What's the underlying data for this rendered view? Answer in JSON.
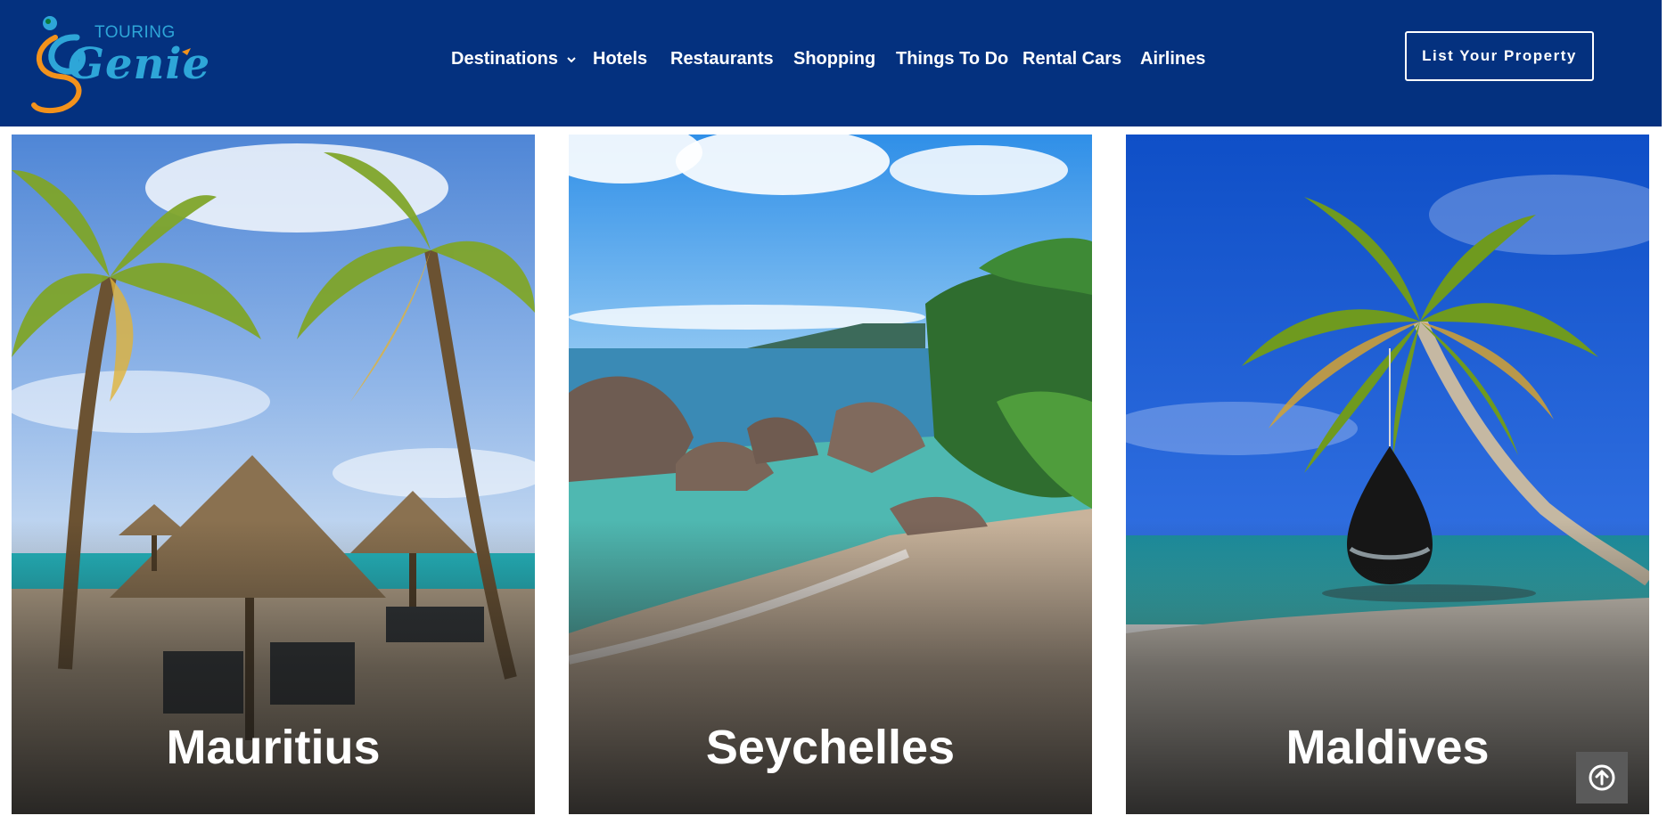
{
  "brand": {
    "small": "TOURING",
    "large": "Genie"
  },
  "nav": {
    "items": [
      {
        "label": "Destinations",
        "has_dropdown": true
      },
      {
        "label": "Hotels"
      },
      {
        "label": "Restaurants"
      },
      {
        "label": "Shopping"
      },
      {
        "label": "Things To Do"
      },
      {
        "label": "Rental Cars"
      },
      {
        "label": "Airlines"
      }
    ]
  },
  "cta": {
    "label": "List Your Property"
  },
  "destinations": [
    {
      "name": "Mauritius"
    },
    {
      "name": "Seychelles"
    },
    {
      "name": "Maldives"
    }
  ],
  "colors": {
    "header_bg": "#04317f",
    "logo_blue": "#2ea6d8",
    "logo_orange": "#f3921b"
  },
  "icons": {
    "dropdown": "chevron-down-icon",
    "back_to_top": "arrow-up-circle-icon"
  }
}
